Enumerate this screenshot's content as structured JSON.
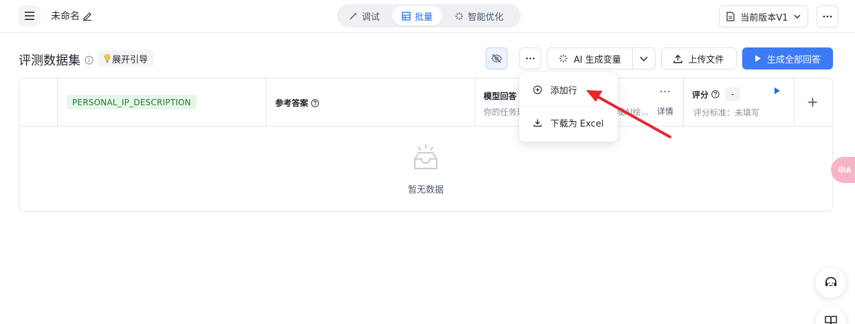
{
  "topbar": {
    "menu_icon": "hamburger-icon",
    "doc_title": "未命名",
    "tabs": [
      {
        "label": "调试",
        "icon": "debug-wand-icon",
        "active": false
      },
      {
        "label": "批量",
        "icon": "table-icon",
        "active": true
      },
      {
        "label": "智能优化",
        "icon": "sparkle-icon",
        "active": false
      }
    ],
    "version_label": "当前版本V1"
  },
  "section": {
    "title": "评测数据集",
    "guide_label": "展开引导"
  },
  "toolbar": {
    "ai_label": "AI 生成变量",
    "upload_label": "上传文件",
    "generate_all_label": "生成全部回答"
  },
  "dropdown": {
    "items": [
      {
        "label": "添加行",
        "icon": "plus-circle-icon"
      },
      {
        "label": "下载为 Excel",
        "icon": "download-icon"
      }
    ]
  },
  "table": {
    "variable_column": "PERSONAL_IP_DESCRIPTION",
    "reference_column": "参考答案",
    "model_column": {
      "name": "模型回答",
      "prompt_start": "你的任务是",
      "prompt_end": "成AI绘...",
      "detail_label": "详情"
    },
    "score_column": {
      "label": "评分",
      "value": "-",
      "standard": "评分标准：未填写"
    },
    "empty_text": "暂无数据"
  },
  "floating": {
    "translate_label": "中A"
  },
  "colors": {
    "primary": "#3c7bf6",
    "tag_green_bg": "#e7f6ea",
    "tag_green_text": "#1d7a36",
    "arrow_red": "#e8262d"
  }
}
